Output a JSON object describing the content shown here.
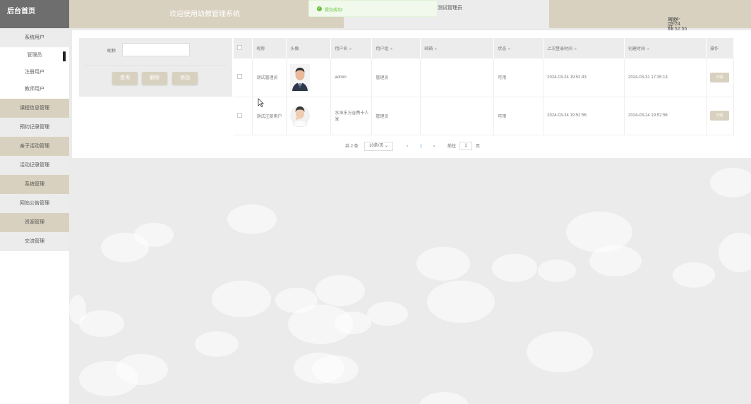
{
  "header": {
    "logo": "后台首页",
    "welcome": "欢迎使用幼教管理系统",
    "current_user": "测试管理员",
    "time_label": "当前时间：",
    "time_value": "2024-03-24 19:52:55"
  },
  "toast": {
    "icon": "check-circle-icon",
    "message": "提交成功!"
  },
  "sidebar": {
    "items": [
      {
        "label": "系统用户"
      },
      {
        "label": "管理员"
      },
      {
        "label": "注册用户"
      },
      {
        "label": "教师用户"
      },
      {
        "label": "课程信息管理"
      },
      {
        "label": "预约记录管理"
      },
      {
        "label": "亲子活动管理"
      },
      {
        "label": "活动记录管理"
      },
      {
        "label": "系统管理"
      },
      {
        "label": "网站公告管理"
      },
      {
        "label": "资源管理"
      },
      {
        "label": "交流管理"
      }
    ]
  },
  "search": {
    "label": "昵称",
    "value": "",
    "buttons": {
      "query": "查询",
      "delete": "删除",
      "add": "添加"
    }
  },
  "table": {
    "headers": [
      "昵称",
      "头像",
      "用户名",
      "用户组",
      "邮箱",
      "状态",
      "上次登录时间",
      "创建时间",
      "操作"
    ],
    "sort_icon": "≑",
    "rows": [
      {
        "nickname": "测试管理员",
        "username": "admin",
        "group": "管理员",
        "email": "",
        "status": "可用",
        "last_login": "2024-03-24 19:52:43",
        "created": "2024-03-31 17:35:13",
        "action": "详情"
      },
      {
        "nickname": "测试注册用户",
        "username": "水深乐万谷费十人发",
        "group": "管理员",
        "email": "",
        "status": "可用",
        "last_login": "2024-03-24 19:52:56",
        "created": "2024-03-24 19:52:56",
        "action": "详情"
      }
    ]
  },
  "pager": {
    "total": "共 2 条",
    "page_size": "10条/页",
    "prev": "‹",
    "current": "1",
    "next": "›",
    "goto_label": "前往",
    "goto_value": "1",
    "page_suffix": "页"
  },
  "colors": {
    "accent": "#d9d1bf",
    "logo_bg": "#6e6e6e",
    "success": "#67c23a"
  }
}
